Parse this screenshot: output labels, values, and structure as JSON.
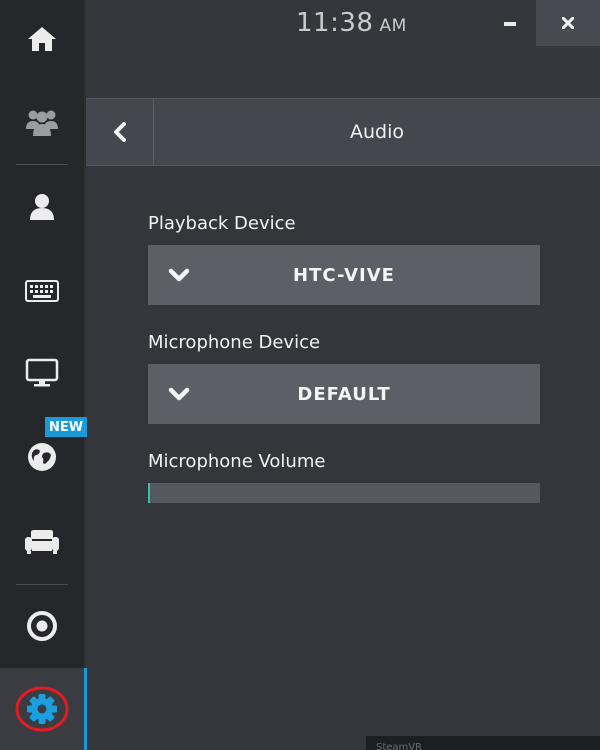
{
  "sidebar": {
    "items": [
      {
        "name": "home",
        "icon": "home-icon"
      },
      {
        "name": "friends",
        "icon": "people-icon"
      },
      {
        "name": "avatar",
        "icon": "person-icon"
      },
      {
        "name": "keyboard",
        "icon": "keyboard-icon"
      },
      {
        "name": "desktop",
        "icon": "monitor-icon"
      },
      {
        "name": "worlds",
        "icon": "globe-icon",
        "badge": "NEW"
      },
      {
        "name": "environments",
        "icon": "couch-icon"
      },
      {
        "name": "record",
        "icon": "circle-target-icon"
      },
      {
        "name": "settings",
        "icon": "gear-icon",
        "active": true
      }
    ],
    "badge_color": "#1a9ad6",
    "active_color": "#1a9ad6"
  },
  "topbar": {
    "time": "11:38",
    "ampm": "AM",
    "minimize_icon": "minimize-icon",
    "close_icon": "close-icon"
  },
  "header": {
    "back_icon": "chevron-left-icon",
    "title": "Audio"
  },
  "audio": {
    "playback_label": "Playback Device",
    "playback_value": "HTC-VIVE",
    "microphone_label": "Microphone Device",
    "microphone_value": "DEFAULT",
    "volume_label": "Microphone Volume",
    "volume_level": 0.005,
    "volume_color": "#31c5a3"
  },
  "footer": {
    "steamvr_label": "SteamVR"
  }
}
